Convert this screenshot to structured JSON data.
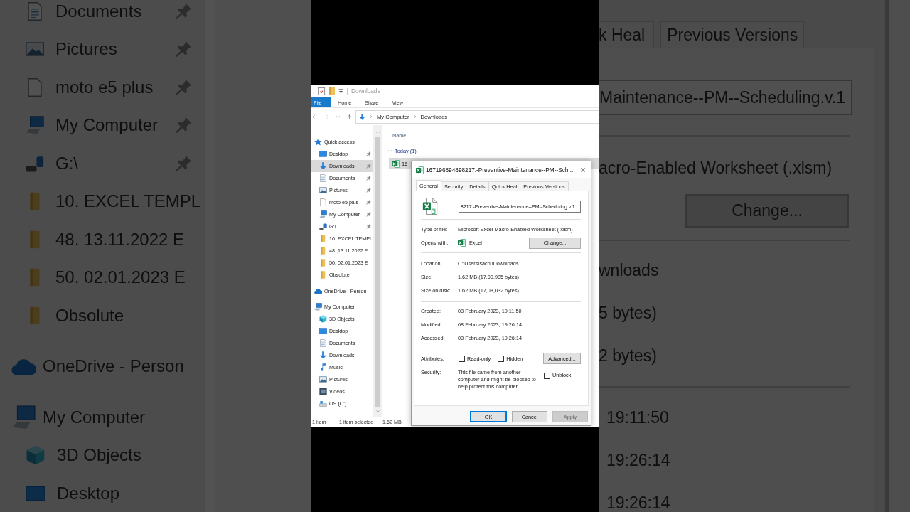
{
  "backdrop_left": {
    "quick_access_items": [
      {
        "label": "Documents",
        "kind": "documents",
        "pinned": true
      },
      {
        "label": "Pictures",
        "kind": "pictures",
        "pinned": true
      },
      {
        "label": "moto e5 plus",
        "kind": "file",
        "pinned": true
      },
      {
        "label": "My Computer",
        "kind": "computer",
        "pinned": true
      },
      {
        "label": "G:\\",
        "kind": "drive",
        "pinned": true
      },
      {
        "label": "10. EXCEL TEMPL",
        "kind": "folder",
        "pinned": false
      },
      {
        "label": "48. 13.11.2022 E",
        "kind": "folder",
        "pinned": false
      },
      {
        "label": "50. 02.01.2023 E",
        "kind": "folder",
        "pinned": false
      },
      {
        "label": "Obsolute",
        "kind": "folder",
        "pinned": false
      }
    ],
    "nav": [
      {
        "label": "OneDrive - Person",
        "kind": "cloud"
      },
      {
        "label": "My Computer",
        "kind": "computer",
        "children": [
          {
            "label": "3D Objects",
            "kind": "objects3d"
          },
          {
            "label": "Desktop",
            "kind": "desktop"
          }
        ]
      }
    ]
  },
  "backdrop_right": {
    "tabs": [
      {
        "label": "k Heal",
        "selected": false
      },
      {
        "label": "Previous Versions",
        "selected": false
      }
    ],
    "file_name": "Maintenance--PM--Scheduling.v.1",
    "type_of_file": "acro-Enabled Worksheet (.xlsm)",
    "change_button": "Change...",
    "details": [
      "wnloads",
      "5 bytes)",
      "2 bytes)"
    ],
    "times": [
      "19:11:50",
      "19:26:14",
      "19:26:14"
    ]
  },
  "explorer": {
    "title": "Downloads",
    "ribbon_tabs": [
      {
        "label": "File",
        "kind": "menu"
      },
      {
        "label": "Home",
        "kind": "tab"
      },
      {
        "label": "Share",
        "kind": "tab"
      },
      {
        "label": "View",
        "kind": "tab"
      }
    ],
    "breadcrumb": [
      "My Computer",
      "Downloads"
    ],
    "nav": [
      {
        "label": "Quick access",
        "kind": "star",
        "selected": false,
        "children": [
          {
            "label": "Desktop",
            "kind": "desktop",
            "pinned": true,
            "selected": false
          },
          {
            "label": "Downloads",
            "kind": "downloads",
            "pinned": true,
            "selected": true
          },
          {
            "label": "Documents",
            "kind": "documents",
            "pinned": true,
            "selected": false
          },
          {
            "label": "Pictures",
            "kind": "pictures",
            "pinned": true,
            "selected": false
          },
          {
            "label": "moto e5 plus",
            "kind": "file",
            "pinned": true,
            "selected": false
          },
          {
            "label": "My Computer",
            "kind": "computer",
            "pinned": true,
            "selected": false
          },
          {
            "label": "G:\\",
            "kind": "drive",
            "pinned": true,
            "selected": false
          },
          {
            "label": "10. EXCEL TEMPL",
            "kind": "folder",
            "pinned": false,
            "selected": false
          },
          {
            "label": "48. 13.11.2022 E",
            "kind": "folder",
            "pinned": false,
            "selected": false
          },
          {
            "label": "50. 02.01.2023 E",
            "kind": "folder",
            "pinned": false,
            "selected": false
          },
          {
            "label": "Obsolute",
            "kind": "folder",
            "pinned": false,
            "selected": false
          }
        ]
      },
      {
        "label": "OneDrive - Person",
        "kind": "cloud",
        "selected": false
      },
      {
        "label": "My Computer",
        "kind": "computer",
        "selected": false,
        "children": [
          {
            "label": "3D Objects",
            "kind": "objects3d",
            "selected": false
          },
          {
            "label": "Desktop",
            "kind": "desktop",
            "selected": false
          },
          {
            "label": "Documents",
            "kind": "documents",
            "selected": false
          },
          {
            "label": "Downloads",
            "kind": "downloads",
            "selected": false
          },
          {
            "label": "Music",
            "kind": "music",
            "selected": false
          },
          {
            "label": "Pictures",
            "kind": "pictures",
            "selected": false
          },
          {
            "label": "Videos",
            "kind": "videos",
            "selected": false
          },
          {
            "label": "OS (C:)",
            "kind": "system_drive",
            "selected": false
          }
        ]
      }
    ],
    "column_header": "Name",
    "group": {
      "label": "Today (1)",
      "expanded": true
    },
    "files": [
      {
        "name": "16",
        "selected": true
      }
    ],
    "status_bar": {
      "item_count": "1 item",
      "selection": "1 item selected",
      "size": "1.62 MB"
    }
  },
  "properties_dialog": {
    "title": "167196894898217.-Preventive-Maintenance--PM--Sch...",
    "tabs": [
      {
        "label": "General",
        "selected": true
      },
      {
        "label": "Security",
        "selected": false
      },
      {
        "label": "Details",
        "selected": false
      },
      {
        "label": "Quick Heal",
        "selected": false
      },
      {
        "label": "Previous Versions",
        "selected": false
      }
    ],
    "file_name": "8217.-Preventive-Maintenance--PM--Scheduling.v.1",
    "sections": [
      {
        "rows": [
          {
            "label": "Type of file:",
            "value": "Microsoft Excel Macro-Enabled Worksheet (.xlsm)"
          },
          {
            "label": "Opens with:",
            "value": "Excel",
            "kind": "app",
            "button": "Change..."
          }
        ]
      },
      {
        "rows": [
          {
            "label": "Location:",
            "value": "C:\\Users\\sachi\\Downloads"
          },
          {
            "label": "Size:",
            "value": "1.62 MB (17,00,985 bytes)"
          },
          {
            "label": "Size on disk:",
            "value": "1.62 MB (17,08,032 bytes)"
          }
        ]
      },
      {
        "rows": [
          {
            "label": "Created:",
            "value": "08 February 2023, 19:11:50"
          },
          {
            "label": "Modified:",
            "value": "08 February 2023, 19:26:14"
          },
          {
            "label": "Accessed:",
            "value": "08 February 2023, 19:26:14"
          }
        ]
      }
    ],
    "attributes": {
      "label": "Attributes:",
      "options": [
        {
          "label": "Read-only",
          "checked": false
        },
        {
          "label": "Hidden",
          "checked": false
        }
      ],
      "button": "Advanced..."
    },
    "security": {
      "label": "Security:",
      "text": "This file came from another computer and might be blocked to help protect this computer.",
      "option": {
        "label": "Unblock",
        "checked": false
      }
    },
    "buttons": [
      {
        "label": "OK",
        "kind": "default",
        "disabled": false
      },
      {
        "label": "Cancel",
        "kind": "normal",
        "disabled": false
      },
      {
        "label": "Apply",
        "kind": "normal",
        "disabled": true
      }
    ]
  }
}
